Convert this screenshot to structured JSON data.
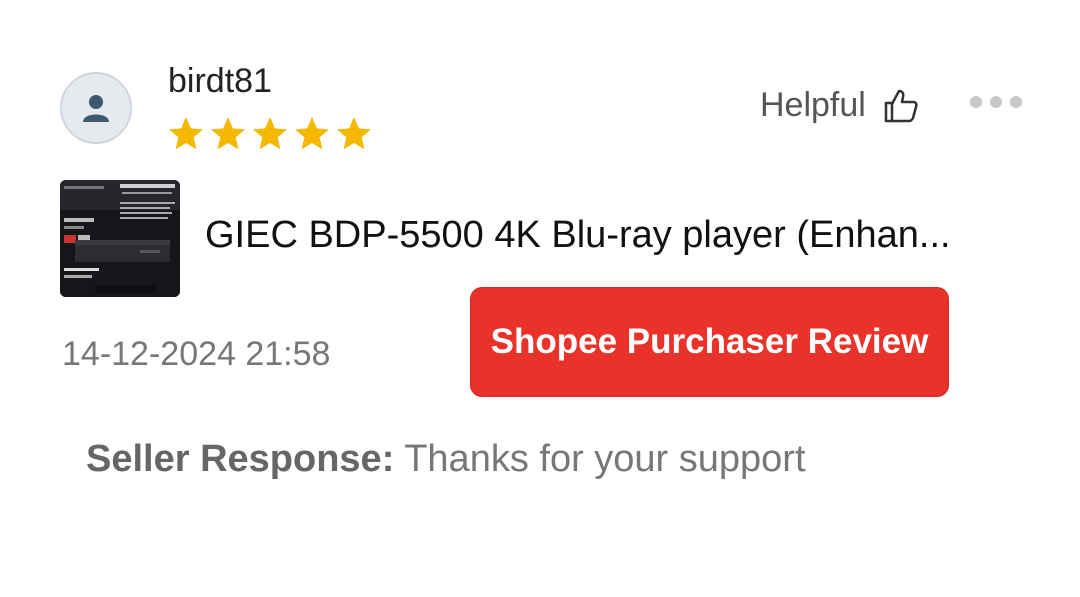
{
  "review": {
    "username": "birdt81",
    "rating": 5,
    "rating_max": 5,
    "star_color": "#f5b800",
    "helpful_label": "Helpful",
    "product_name": "GIEC BDP-5500 4K Blu-ray player  (Enhan...",
    "date": "14-12-2024 21:58",
    "badge_label": "Shopee Purchaser Review",
    "badge_color": "#e8322a",
    "seller_response_label": "Seller Response:",
    "seller_response_text": " Thanks for your support"
  },
  "icons": {
    "avatar": "person-icon",
    "helpful": "thumbs-up-icon",
    "more": "more-options-icon"
  }
}
